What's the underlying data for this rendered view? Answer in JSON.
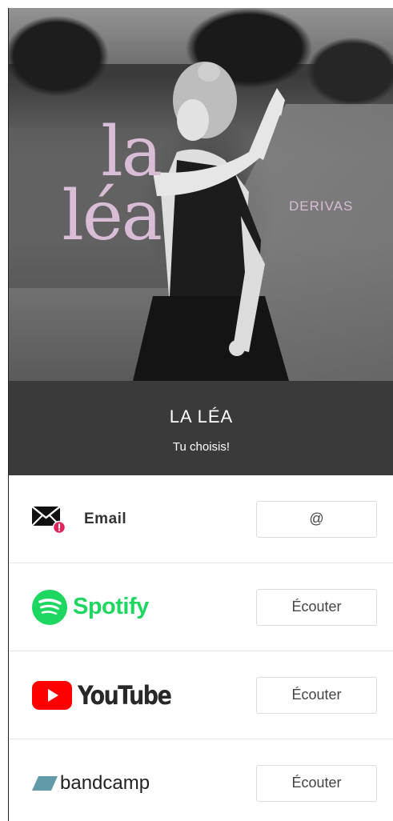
{
  "cover": {
    "title_line1": "la",
    "title_line2": "léa",
    "subtitle": "DERIVAS"
  },
  "header": {
    "artist": "LA LÉA",
    "tagline": "Tu choisis!"
  },
  "services": [
    {
      "name": "Email",
      "icon": "email-icon",
      "button": "@"
    },
    {
      "name": "Spotify",
      "icon": "spotify-icon",
      "button": "Écouter"
    },
    {
      "name": "YouTube",
      "icon": "youtube-icon",
      "button": "Écouter"
    },
    {
      "name": "bandcamp",
      "icon": "bandcamp-icon",
      "button": "Écouter"
    }
  ],
  "colors": {
    "title_pink": "#d9bcd6",
    "band": "#3a3a3a",
    "spotify": "#1ed760",
    "youtube": "#ff0000",
    "bandcamp": "#629aa9",
    "email_badge": "#e0245e"
  }
}
